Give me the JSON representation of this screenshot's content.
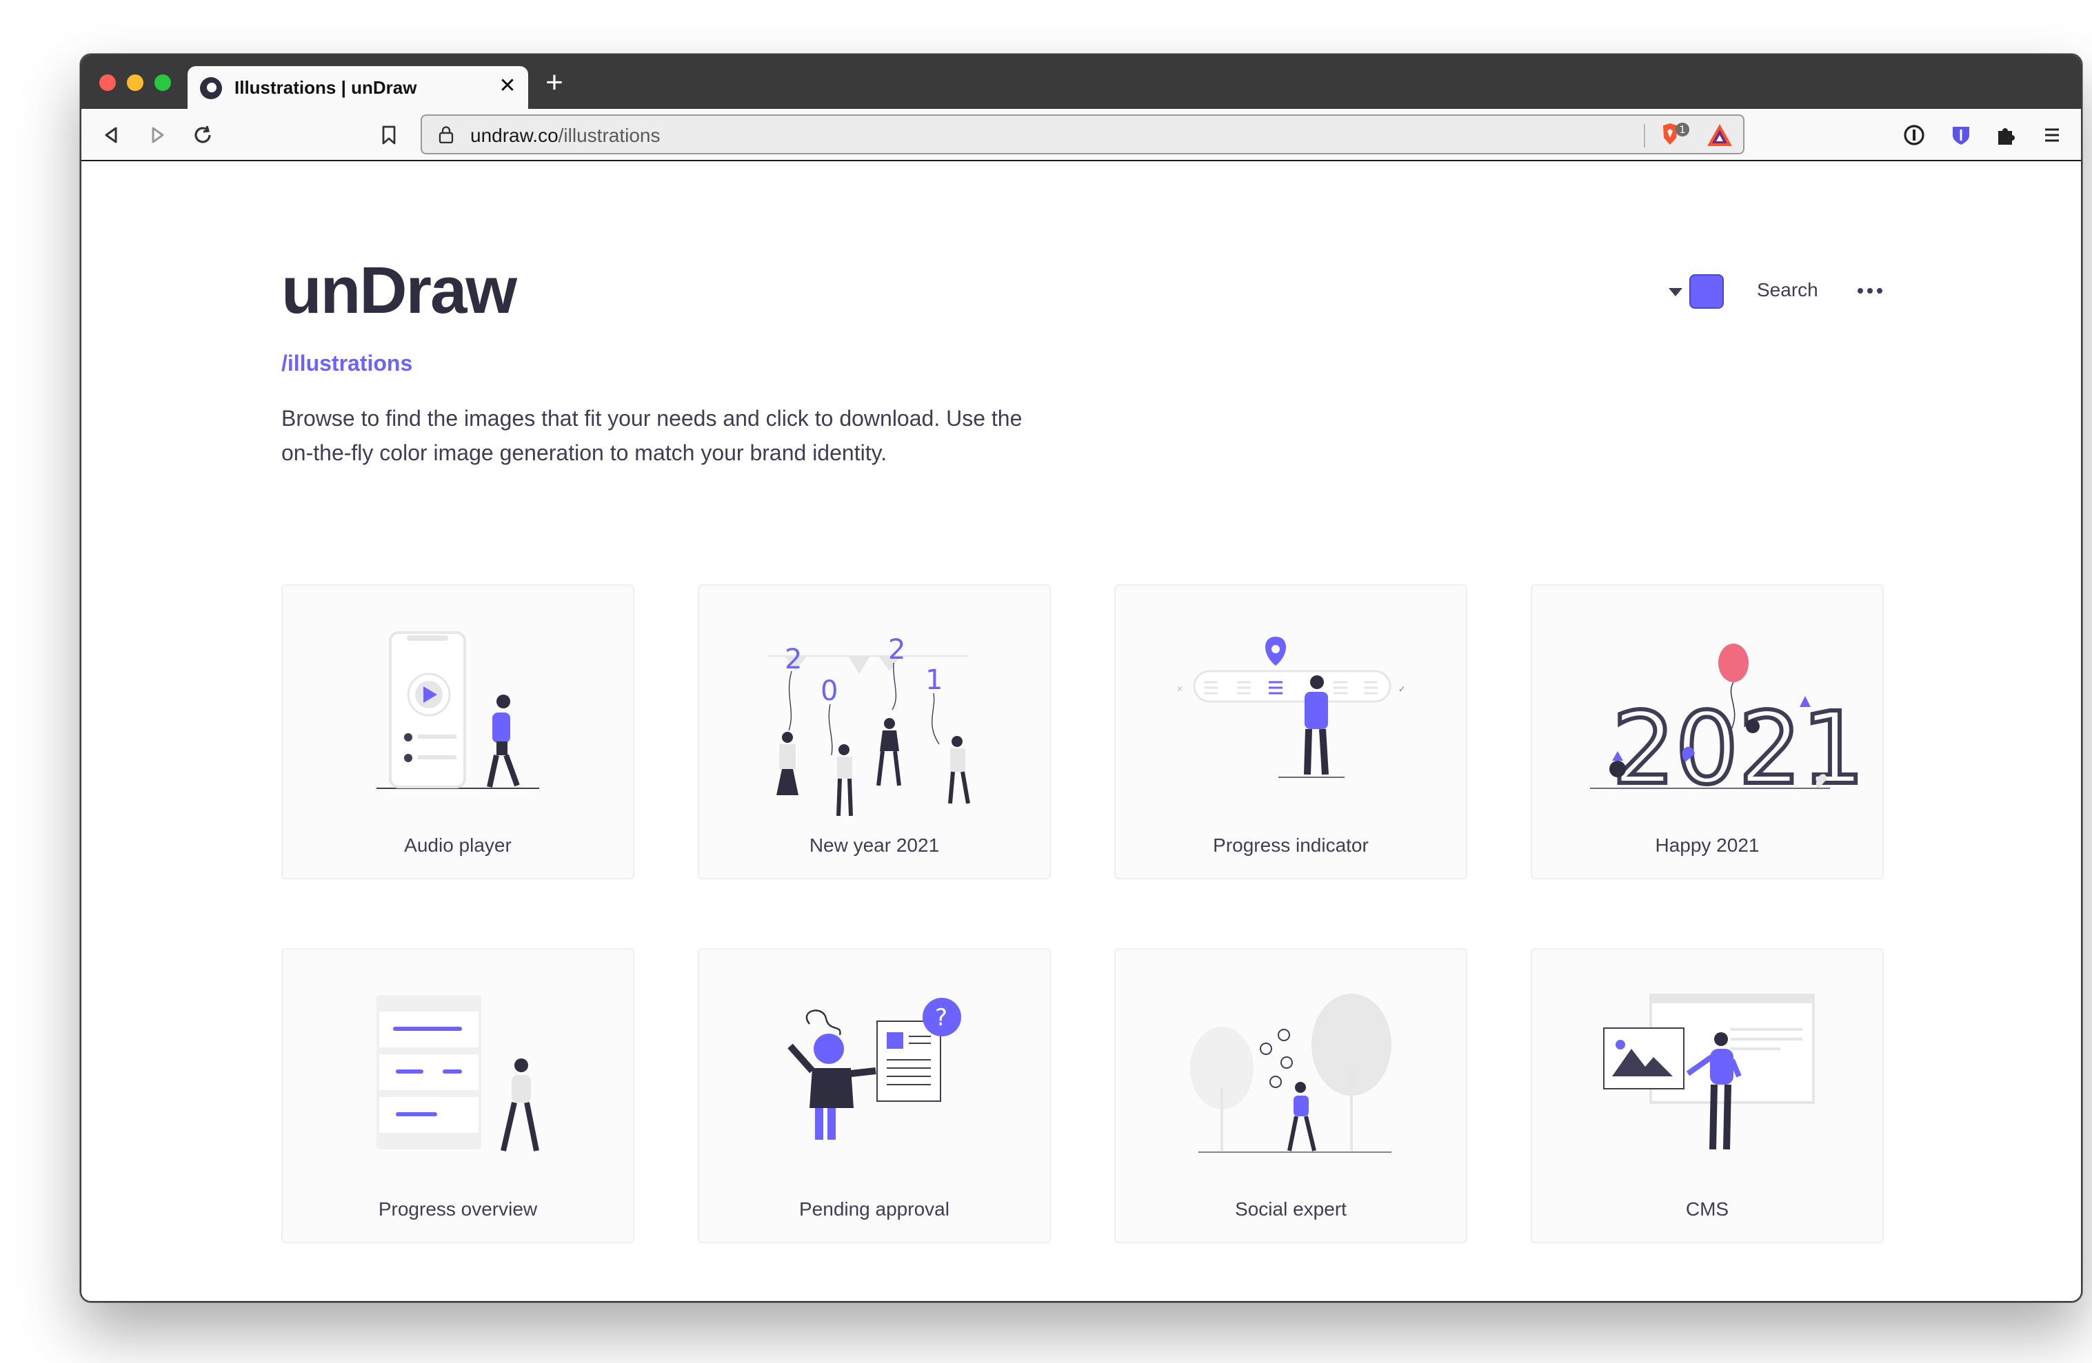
{
  "browser": {
    "tab_title": "Illustrations | unDraw",
    "url_host": "undraw.co",
    "url_path": "/illustrations",
    "shield_badge": "1"
  },
  "header": {
    "logo": "unDraw",
    "subpath": "/illustrations",
    "description": "Browse to find the images that fit your needs and click to download. Use the on-the-fly color image generation to match your brand identity.",
    "accent_color": "#6c63ff",
    "search_label": "Search"
  },
  "illustrations": [
    {
      "title": "Audio player"
    },
    {
      "title": "New year 2021"
    },
    {
      "title": "Progress indicator"
    },
    {
      "title": "Happy 2021"
    },
    {
      "title": "Progress overview"
    },
    {
      "title": "Pending approval"
    },
    {
      "title": "Social expert"
    },
    {
      "title": "CMS"
    }
  ],
  "colors": {
    "accent": "#6c63ff",
    "dark": "#2f2e41",
    "text": "#3f3d56",
    "pink": "#f06b7f"
  }
}
